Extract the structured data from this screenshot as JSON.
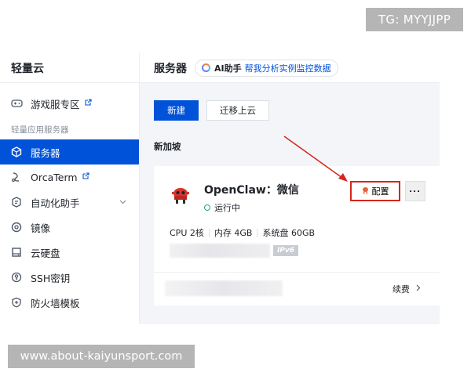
{
  "watermarks": {
    "top": "TG: MYYJJPP",
    "bottom": "www.about-kaiyunsport.com"
  },
  "sidebar": {
    "title": "轻量云",
    "top_item": {
      "label": "游戏服专区",
      "icon": "gamepad-icon"
    },
    "group_label": "轻量应用服务器",
    "items": [
      {
        "label": "服务器",
        "icon": "cube-icon",
        "active": true
      },
      {
        "label": "OrcaTerm",
        "icon": "terminal-icon",
        "external": true
      },
      {
        "label": "自动化助手",
        "icon": "automation-icon",
        "expandable": true
      },
      {
        "label": "镜像",
        "icon": "disc-icon"
      },
      {
        "label": "云硬盘",
        "icon": "disk-icon"
      },
      {
        "label": "SSH密钥",
        "icon": "key-icon"
      },
      {
        "label": "防火墙模板",
        "icon": "shield-icon"
      }
    ]
  },
  "header": {
    "title": "服务器",
    "ai": {
      "name": "AI助手",
      "link": "帮我分析实例监控数据"
    }
  },
  "toolbar": {
    "new_label": "新建",
    "migrate_label": "迁移上云"
  },
  "region": "新加坡",
  "instance": {
    "name": "OpenClaw：微信",
    "status": "运行中",
    "config_label": "配置",
    "more_label": "···",
    "specs": [
      "CPU 2核",
      "内存 4GB",
      "系统盘 60GB"
    ],
    "ipv6_badge": "IPv6",
    "renew_label": "续费"
  },
  "colors": {
    "accent": "#0052d9",
    "highlight": "#d4281c",
    "status_ok": "#2ba471"
  }
}
